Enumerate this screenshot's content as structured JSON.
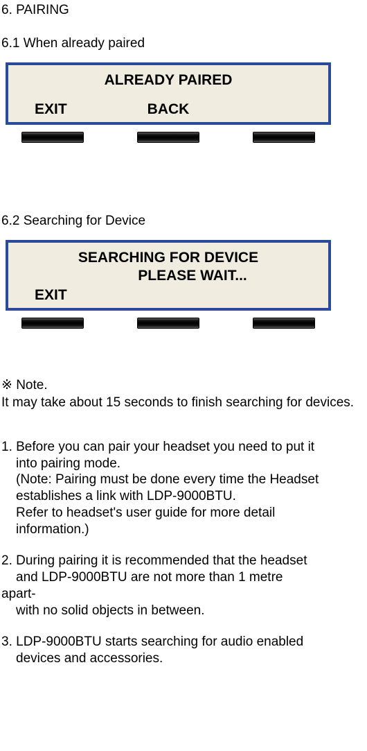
{
  "section": {
    "title": "6. PAIRING",
    "sub1": "6.1 When already paired",
    "sub2": "6.2 Searching for Device"
  },
  "lcd1": {
    "line1": "ALREADY PAIRED",
    "sk_left": "EXIT",
    "sk_center": "BACK",
    "sk_right": ""
  },
  "lcd2": {
    "line1": "SEARCHING FOR DEVICE",
    "line2": "PLEASE WAIT...",
    "sk_left": "EXIT",
    "sk_center": "",
    "sk_right": ""
  },
  "note": {
    "label": "※ Note.",
    "text": "It may take about 15 seconds to finish searching for devices."
  },
  "steps": {
    "s1_l1": "1. Before you can pair your headset you need to put it",
    "s1_l2": "into pairing mode.",
    "s1_l3": "(Note: Pairing must be done every time the Headset",
    "s1_l4": "establishes a link with LDP-9000BTU.",
    "s1_l5": "Refer to headset's user guide for more detail",
    "s1_l6": "information.)",
    "s2_l1": "2. During pairing it is recommended that the headset",
    "s2_l2": "and LDP-9000BTU are not more than 1 metre",
    "s2_l3": "apart-",
    "s2_l4": "with no solid objects in between.",
    "s3_l1": "3. LDP-9000BTU starts searching for audio enabled",
    "s3_l2": "devices and accessories."
  }
}
